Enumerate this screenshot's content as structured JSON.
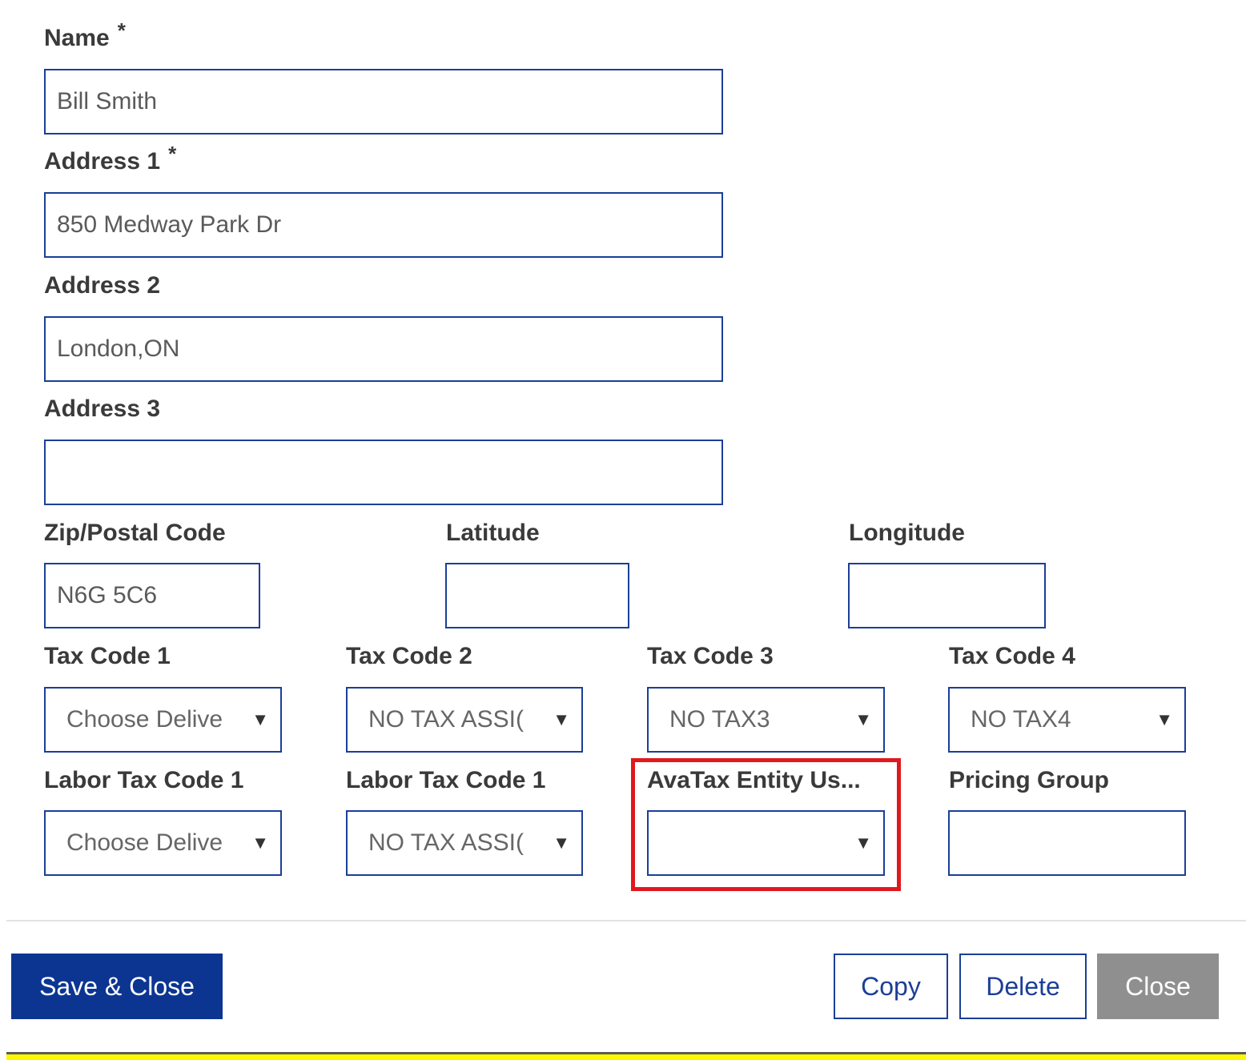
{
  "form": {
    "name": {
      "label": "Name",
      "required_mark": "*",
      "value": "Bill Smith"
    },
    "address1": {
      "label": "Address 1",
      "required_mark": "*",
      "value": "850 Medway Park Dr"
    },
    "address2": {
      "label": "Address 2",
      "value": "London,ON"
    },
    "address3": {
      "label": "Address 3",
      "value": ""
    },
    "zip": {
      "label": "Zip/Postal Code",
      "value": "N6G 5C6"
    },
    "latitude": {
      "label": "Latitude",
      "value": ""
    },
    "longitude": {
      "label": "Longitude",
      "value": ""
    },
    "tax_code_1": {
      "label": "Tax Code 1",
      "selected": "Choose Delive"
    },
    "tax_code_2": {
      "label": "Tax Code 2",
      "selected": "NO TAX ASSI("
    },
    "tax_code_3": {
      "label": "Tax Code 3",
      "selected": "NO TAX3"
    },
    "tax_code_4": {
      "label": "Tax Code 4",
      "selected": "NO TAX4"
    },
    "labor_tax_code_1a": {
      "label": "Labor Tax Code 1",
      "selected": "Choose Delive"
    },
    "labor_tax_code_1b": {
      "label": "Labor Tax Code 1",
      "selected": "NO TAX ASSI("
    },
    "avatax_entity": {
      "label": "AvaTax Entity Us...",
      "selected": ""
    },
    "pricing_group": {
      "label": "Pricing Group",
      "value": ""
    }
  },
  "dropdown_arrow": "▼",
  "buttons": {
    "save_close": "Save & Close",
    "copy": "Copy",
    "delete": "Delete",
    "close": "Close"
  },
  "colors": {
    "primary": "#0c3592",
    "field_border": "#1b3f97",
    "highlight": "#e0191f",
    "disabled_button": "#8f8f8f",
    "bottom_accent": "#fff700"
  }
}
